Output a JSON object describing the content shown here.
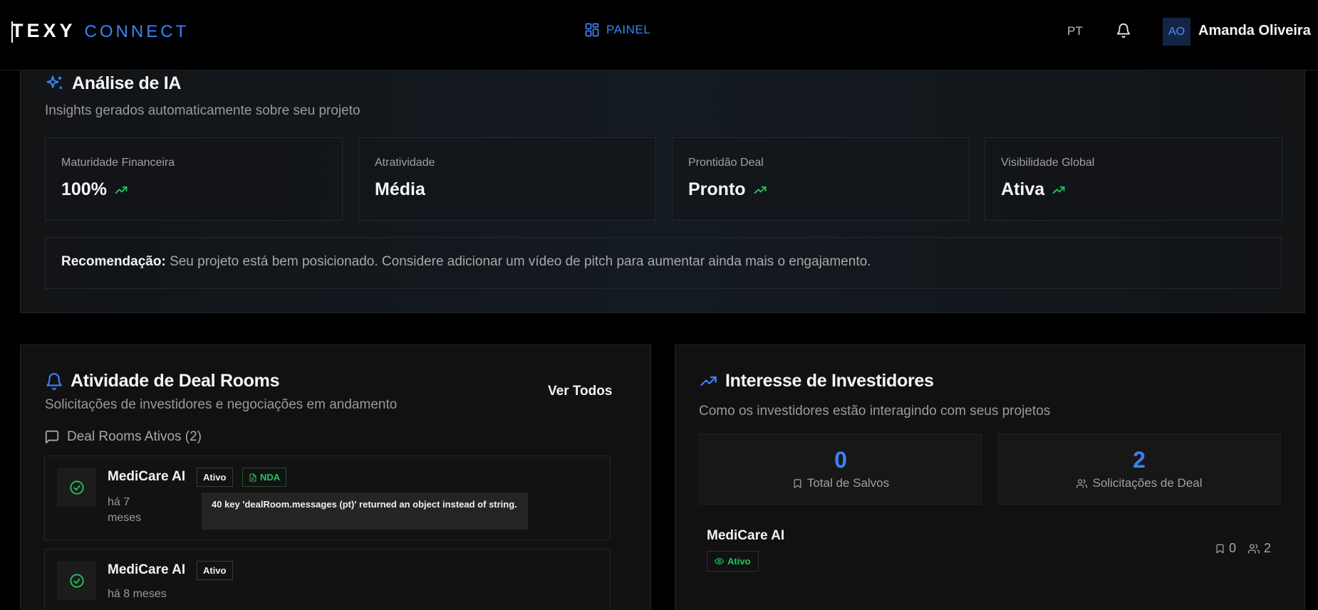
{
  "header": {
    "logo_primary": "TEXY",
    "logo_secondary": "CONNECT",
    "nav_label": "PAINEL",
    "language": "PT",
    "avatar_initials": "AO",
    "user_name": "Amanda Oliveira"
  },
  "ai_analysis": {
    "title": "Análise de IA",
    "subtitle": "Insights gerados automaticamente sobre seu projeto",
    "metrics": [
      {
        "label": "Maturidade Financeira",
        "value": "100%",
        "trend_icon": "trending-up-icon"
      },
      {
        "label": "Atratividade",
        "value": "Média"
      },
      {
        "label": "Prontidão Deal",
        "value": "Pronto",
        "trend_icon": "trending-up-icon"
      },
      {
        "label": "Visibilidade Global",
        "value": "Ativa",
        "trend_icon": "trending-up-icon"
      }
    ],
    "recommendation_label": "Recomendação:",
    "recommendation_text": "Seu projeto está bem posicionado. Considere adicionar um vídeo de pitch para aumentar ainda mais o engajamento."
  },
  "deal_rooms": {
    "title": "Atividade de Deal Rooms",
    "subtitle": "Solicitações de investidores e negociações em andamento",
    "view_all": "Ver Todos",
    "active_heading": "Deal Rooms Ativos (2)",
    "rooms": [
      {
        "name": "MediCare AI",
        "status": "Ativo",
        "nda": "NDA",
        "time": "há 7 meses",
        "tooltip": "40 key 'dealRoom.messages (pt)' returned an object instead of string."
      },
      {
        "name": "MediCare AI",
        "status": "Ativo",
        "time": "há 8 meses"
      }
    ]
  },
  "investor_interest": {
    "title": "Interesse de Investidores",
    "subtitle": "Como os investidores estão interagindo com seus projetos",
    "stats": [
      {
        "value": "0",
        "label": "Total de Salvos"
      },
      {
        "value": "2",
        "label": "Solicitações de Deal"
      }
    ],
    "project": {
      "name": "MediCare AI",
      "status": "Ativo",
      "saves": "0",
      "requests": "2"
    }
  },
  "colors": {
    "accent": "#3b82f6",
    "success": "#22c55e",
    "background": "#000000",
    "card": "#111111"
  }
}
